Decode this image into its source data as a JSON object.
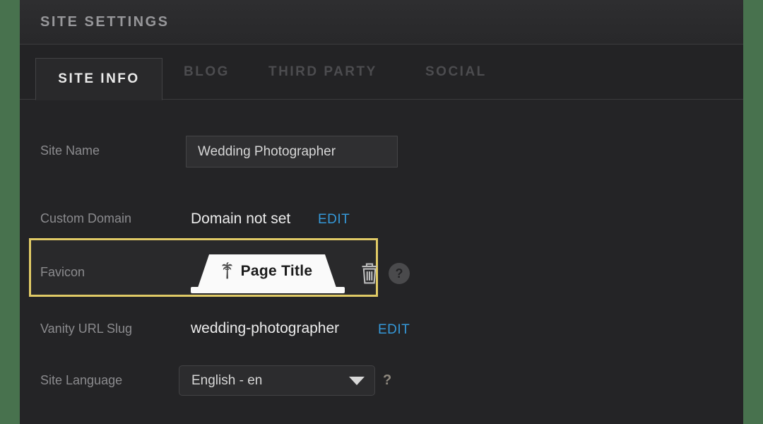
{
  "window": {
    "title": "SITE SETTINGS"
  },
  "tabs": [
    {
      "label": "SITE INFO",
      "active": true
    },
    {
      "label": "BLOG",
      "active": false
    },
    {
      "label": "THIRD PARTY",
      "active": false
    },
    {
      "label": "SOCIAL",
      "active": false
    }
  ],
  "form": {
    "site_name": {
      "label": "Site Name",
      "value": "Wedding Photographer"
    },
    "custom_domain": {
      "label": "Custom Domain",
      "value": "Domain not set",
      "edit_label": "EDIT"
    },
    "favicon": {
      "label": "Favicon",
      "preview_tab_title": "Page Title",
      "favicon_icon": "palm-tree-icon",
      "delete_icon": "trash-icon",
      "help_glyph": "?"
    },
    "vanity_url": {
      "label": "Vanity URL Slug",
      "value": "wedding-photographer",
      "edit_label": "EDIT"
    },
    "site_language": {
      "label": "Site Language",
      "value": "English - en",
      "help_glyph": "?"
    }
  },
  "colors": {
    "frame_green": "#48724e",
    "panel_bg": "#242426",
    "highlight_border": "#e0ca66",
    "link_blue": "#3598d8",
    "active_tab_text": "#ebebeb",
    "inactive_tab_text": "#4c4c4f"
  }
}
